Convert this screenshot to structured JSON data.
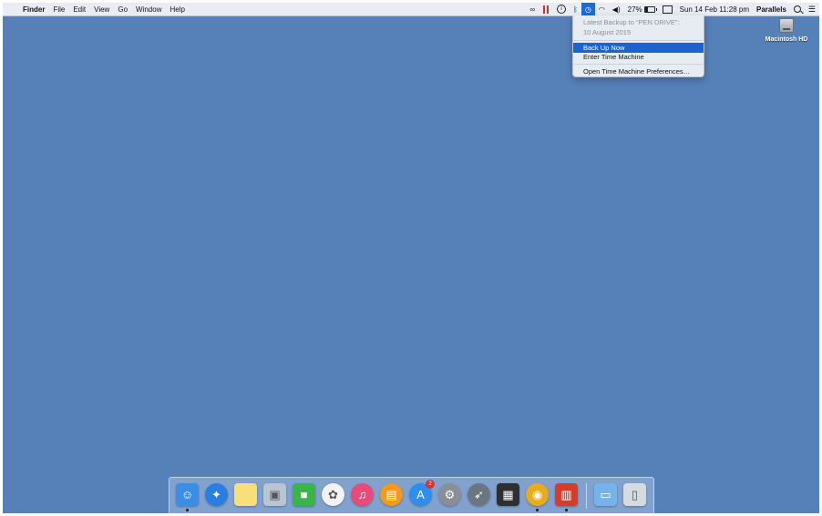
{
  "menubar": {
    "apple": "",
    "app_name": "Finder",
    "menus": [
      "File",
      "Edit",
      "View",
      "Go",
      "Window",
      "Help"
    ],
    "status": {
      "battery_percent": "27%",
      "datetime": "Sun 14 Feb  11:28 pm",
      "user": "Parallels"
    }
  },
  "time_machine_menu": {
    "status_line1": "Latest Backup to “PEN DRIVE”:",
    "status_line2": "10 August 2015",
    "items": [
      "Back Up Now",
      "Enter Time Machine",
      "Open Time Machine Preferences…"
    ]
  },
  "desktop": {
    "drive_label": "Macintosh HD"
  },
  "dock": {
    "items": [
      {
        "name": "finder",
        "color": "#3a8ee6",
        "running": true
      },
      {
        "name": "safari",
        "color": "#2a7de1",
        "running": false
      },
      {
        "name": "notes",
        "color": "#f7e07a",
        "running": false
      },
      {
        "name": "preview",
        "color": "#b9c5d2",
        "running": false
      },
      {
        "name": "facetime",
        "color": "#3bb54a",
        "running": false
      },
      {
        "name": "photos",
        "color": "#f2f2f2",
        "running": false
      },
      {
        "name": "itunes",
        "color": "#e84b7a",
        "running": false
      },
      {
        "name": "ibooks",
        "color": "#f39a1e",
        "running": false
      },
      {
        "name": "app-store",
        "color": "#2d8ef0",
        "running": false,
        "badge": "2"
      },
      {
        "name": "system-preferences",
        "color": "#8a8f96",
        "running": false
      },
      {
        "name": "launchpad",
        "color": "#6c7682",
        "running": false
      },
      {
        "name": "dashboard",
        "color": "#2f2f2f",
        "running": false
      },
      {
        "name": "chrome",
        "color": "#e9ad1b",
        "running": true
      },
      {
        "name": "parallels-desktop",
        "color": "#d93a2b",
        "running": true
      },
      {
        "name": "applications-folder",
        "color": "#76b3e8",
        "running": false
      },
      {
        "name": "trash",
        "color": "#d6dbe2",
        "running": false
      }
    ]
  },
  "colors": {
    "desktop": "#5580b8",
    "highlight": "#1b63cf"
  }
}
